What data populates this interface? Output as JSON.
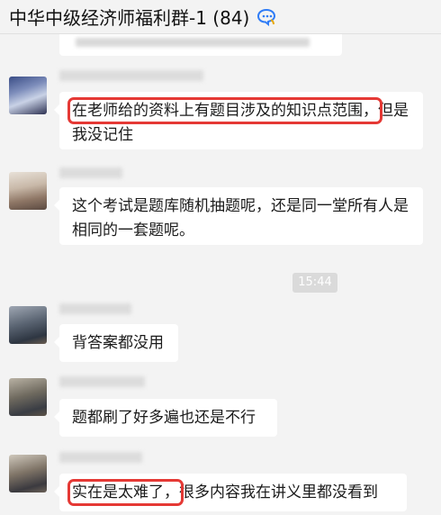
{
  "header": {
    "title": "中华中级经济师福利群-1 (84)",
    "group_icon": "group-chat-icon"
  },
  "time_divider": "15:44",
  "messages": [
    {
      "text_parts": [
        "在老师给的资料上有题目涉及的知识点范围，",
        "但是我没记住"
      ],
      "highlighted": true
    },
    {
      "text_parts": [
        "这个考试是题库随机抽题呢，还是同一堂所有人是相同的一套题呢。"
      ]
    },
    {
      "text_parts": [
        "背答案都没用"
      ]
    },
    {
      "text_parts": [
        "题都刷了好多遍也还是不行"
      ]
    },
    {
      "text_parts": [
        "实在是太难了，",
        "很多内容我在讲义里都没看到"
      ],
      "highlighted": true
    }
  ],
  "colors": {
    "highlight": "#e53935",
    "bubble": "#ffffff",
    "background": "#f3f3f3"
  }
}
